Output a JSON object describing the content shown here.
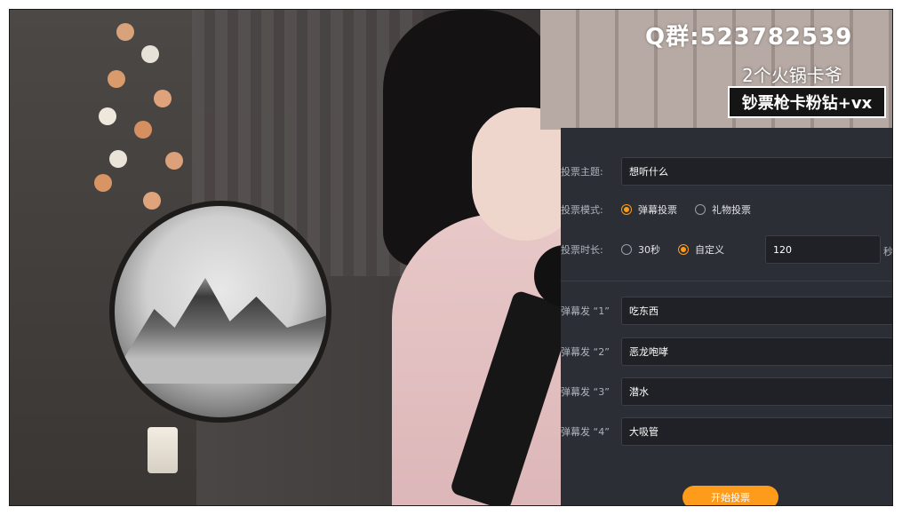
{
  "overlay": {
    "qq_group": "Q群:523782539",
    "hotpot_text": "2个火锅卡爷",
    "promo_text": "钞票枪卡粉钻+vx"
  },
  "vote_panel": {
    "topic_label": "投票主题:",
    "topic_value": "想听什么",
    "mode_label": "投票模式:",
    "mode_options": [
      "弹幕投票",
      "礼物投票"
    ],
    "mode_selected": "弹幕投票",
    "duration_label": "投票时长:",
    "duration_options": [
      "30秒",
      "自定义"
    ],
    "duration_selected": "自定义",
    "duration_value": "120",
    "duration_unit": "秒",
    "options": [
      {
        "label": "弹幕发 “1”",
        "value": "吃东西"
      },
      {
        "label": "弹幕发 “2”",
        "value": "恶龙咆哮"
      },
      {
        "label": "弹幕发 “3”",
        "value": "潜水"
      },
      {
        "label": "弹幕发 “4”",
        "value": "大吸管"
      }
    ],
    "start_button": "开始投票",
    "accent_color": "#ff9b1a"
  }
}
